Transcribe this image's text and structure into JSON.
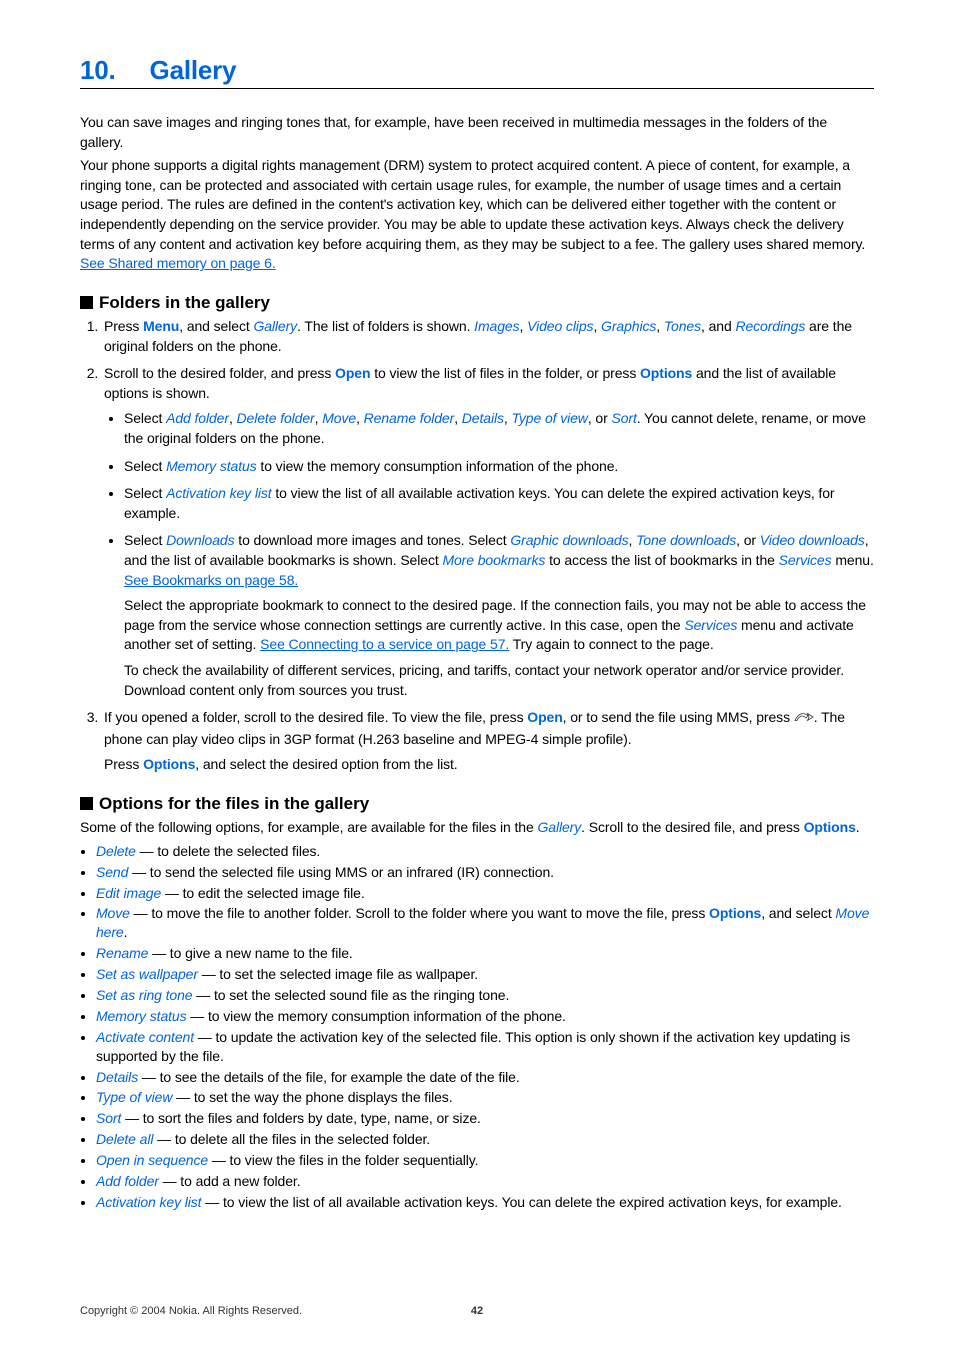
{
  "title": {
    "number": "10.",
    "text": "Gallery"
  },
  "intro": {
    "p1": "You can save images and ringing tones that, for example, have been received in multimedia messages in the folders of the gallery.",
    "p2_pre": "Your phone supports a digital rights management (DRM) system to protect acquired content. A piece of content, for example, a ringing tone, can be protected and associated with certain usage rules, for example, the number of usage times and a certain usage period. The rules are defined in the content's activation key, which can be delivered either together with the content or independently depending on the service provider. You may be able to update these activation keys. Always check the delivery terms of any content and activation key before acquiring them, as they may be subject to a fee. The gallery uses shared memory. ",
    "p2_link": "See Shared memory on page 6."
  },
  "section1": {
    "heading": "Folders in the gallery",
    "step1": {
      "pre1": "Press ",
      "menu": "Menu",
      "mid1": ", and select ",
      "gallery": "Gallery",
      "mid2": ". The list of folders is shown. ",
      "items": [
        "Images",
        "Video clips",
        "Graphics",
        "Tones",
        "Recordings"
      ],
      "sep": ", ",
      "and": ", and ",
      "post1": " are the original folders on the phone."
    },
    "step2": {
      "pre": "Scroll to the desired folder, and press ",
      "open": "Open",
      "mid": " to view the list of files in the folder, or press ",
      "options": "Options",
      "post": " and the list of available options is shown.",
      "b1": {
        "pre": "Select ",
        "items": [
          "Add folder",
          "Delete folder",
          "Move",
          "Rename folder",
          "Details",
          "Type of view",
          "Sort"
        ],
        "post": ". You cannot delete, rename, or move the original folders on the phone."
      },
      "b2": {
        "pre": "Select ",
        "k": "Memory status",
        "post": " to view the memory consumption information of the phone."
      },
      "b3": {
        "pre": "Select ",
        "k": "Activation key list",
        "post": " to view the list of all available activation keys. You can delete the expired activation keys, for example."
      },
      "b4": {
        "pre": "Select ",
        "k1": "Downloads",
        "mid1": " to download more images and tones. Select ",
        "list1": [
          "Graphic downloads",
          "Tone downloads",
          "Video downloads"
        ],
        "mid2": ", and the list of available bookmarks is shown. Select ",
        "k2": "More bookmarks",
        "mid3": " to access the list of bookmarks in the ",
        "k3": "Services",
        "mid4": " menu. ",
        "link1": "See Bookmarks on page 58.",
        "sp1_pre": "Select the appropriate bookmark to connect to the desired page. If the connection fails, you may not be able to access the page from the service whose connection settings are currently active. In this case, open the ",
        "sp1_k": "Services",
        "sp1_mid": " menu and activate another set of setting. ",
        "sp1_link": "See Connecting to a service on page 57.",
        "sp1_post": " Try again to connect to the page.",
        "sp2": "To check the availability of different services, pricing, and tariffs, contact your network operator and/or service provider. Download content only from sources you trust."
      }
    },
    "step3": {
      "p1_pre": "If you opened a folder, scroll to the desired file. To view the file, press ",
      "open": "Open",
      "p1_mid": ", or to send the file using MMS, press ",
      "p1_post": ". The phone can play video clips in 3GP format (H.263 baseline and MPEG-4 simple profile).",
      "p2_pre": "Press ",
      "options": "Options",
      "p2_post": ", and select the desired option from the list."
    }
  },
  "section2": {
    "heading": "Options for the files in the gallery",
    "intro_pre": "Some of the following options, for example, are available for the files in the ",
    "gallery": "Gallery",
    "intro_mid": ". Scroll to the desired file, and press ",
    "options": "Options",
    "intro_post": ".",
    "items": [
      {
        "k": "Delete",
        "t": " — to delete the selected files."
      },
      {
        "k": "Send",
        "t": " — to send the selected file using MMS or an infrared (IR) connection."
      },
      {
        "k": "Edit image",
        "t": " — to edit the selected image file."
      },
      {
        "k": "Move",
        "t_pre": " — to move the file to another folder. Scroll to the folder where you want to move the file, press ",
        "bold": "Options",
        "t_mid": ", and select ",
        "k2": "Move here",
        "t_post": "."
      },
      {
        "k": "Rename",
        "t": " — to give a new name to the file."
      },
      {
        "k": "Set as wallpaper",
        "t": " — to set the selected image file as wallpaper."
      },
      {
        "k": "Set as ring tone",
        "t": " — to set the selected sound file as the ringing tone."
      },
      {
        "k": "Memory status",
        "t": " — to view the memory consumption information of the phone."
      },
      {
        "k": "Activate content",
        "t": " — to update the activation key of the selected file. This option is only shown if the activation key updating is supported by the file."
      },
      {
        "k": "Details",
        "t": " — to see the details of the file, for example the date of the file."
      },
      {
        "k": "Type of view",
        "t": " — to set the way the phone displays the files."
      },
      {
        "k": "Sort",
        "t": " — to sort the files and folders by date, type, name, or size."
      },
      {
        "k": "Delete all",
        "t": " — to delete all the files in the selected folder."
      },
      {
        "k": "Open in sequence",
        "t": " — to view the files in the folder sequentially."
      },
      {
        "k": "Add folder",
        "t": " — to add a new folder."
      },
      {
        "k": "Activation key list",
        "t": " — to view the list of all available activation keys. You can delete the expired activation keys, for example."
      }
    ]
  },
  "footer": {
    "copyright": "Copyright © 2004 Nokia. All Rights Reserved.",
    "page": "42"
  }
}
